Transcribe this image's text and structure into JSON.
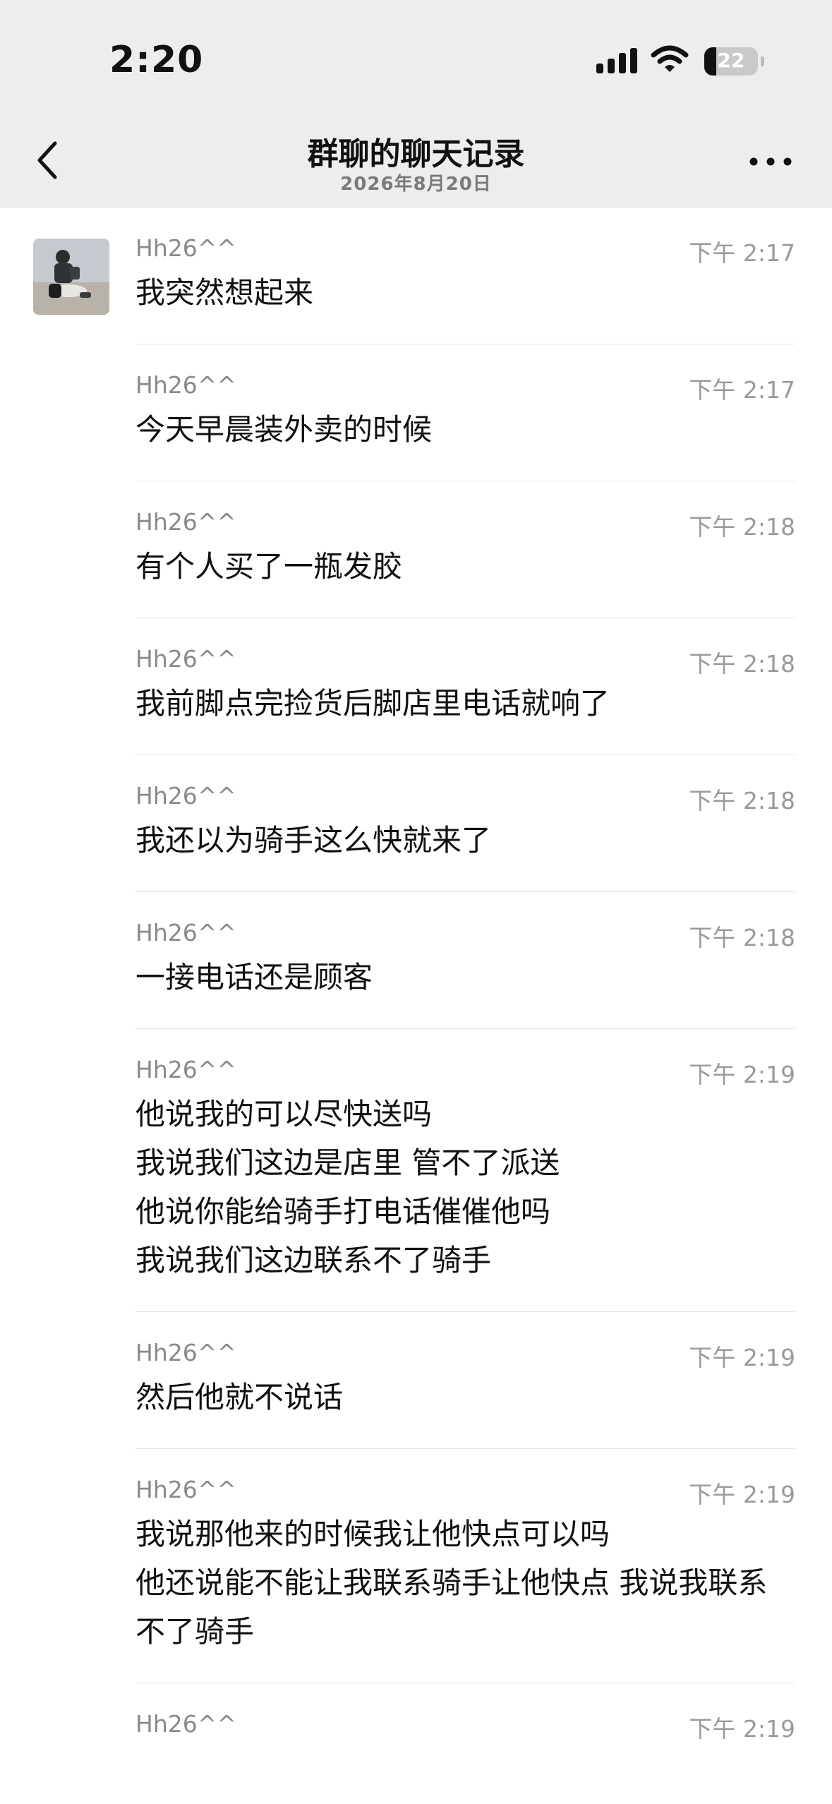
{
  "status_bar": {
    "time": "2:20",
    "battery": "22",
    "battery_level": 0.22,
    "icons": [
      "signal-icon",
      "wifi-icon",
      "battery-icon"
    ]
  },
  "nav": {
    "title": "群聊的聊天记录",
    "subtitle": "2026年8月20日",
    "back_icon": "chevron-left-icon",
    "more_icon": "more-dots-icon"
  },
  "messages": [
    {
      "sender": "Hh26^^",
      "time": "下午 2:17",
      "lines": [
        "我突然想起来"
      ]
    },
    {
      "sender": "Hh26^^",
      "time": "下午 2:17",
      "lines": [
        "今天早晨装外卖的时候"
      ]
    },
    {
      "sender": "Hh26^^",
      "time": "下午 2:18",
      "lines": [
        "有个人买了一瓶发胶"
      ]
    },
    {
      "sender": "Hh26^^",
      "time": "下午 2:18",
      "lines": [
        "我前脚点完捡货后脚店里电话就响了"
      ]
    },
    {
      "sender": "Hh26^^",
      "time": "下午 2:18",
      "lines": [
        "我还以为骑手这么快就来了"
      ]
    },
    {
      "sender": "Hh26^^",
      "time": "下午 2:18",
      "lines": [
        "一接电话还是顾客"
      ]
    },
    {
      "sender": "Hh26^^",
      "time": "下午 2:19",
      "lines": [
        "他说我的可以尽快送吗",
        "我说我们这边是店里 管不了派送",
        "他说你能给骑手打电话催催他吗",
        "我说我们这边联系不了骑手"
      ]
    },
    {
      "sender": "Hh26^^",
      "time": "下午 2:19",
      "lines": [
        "然后他就不说话"
      ]
    },
    {
      "sender": "Hh26^^",
      "time": "下午 2:19",
      "lines": [
        "我说那他来的时候我让他快点可以吗",
        "他还说能不能让我联系骑手让他快点 我说我联系不了骑手"
      ]
    },
    {
      "sender": "Hh26^^",
      "time": "下午 2:19",
      "lines": []
    }
  ]
}
